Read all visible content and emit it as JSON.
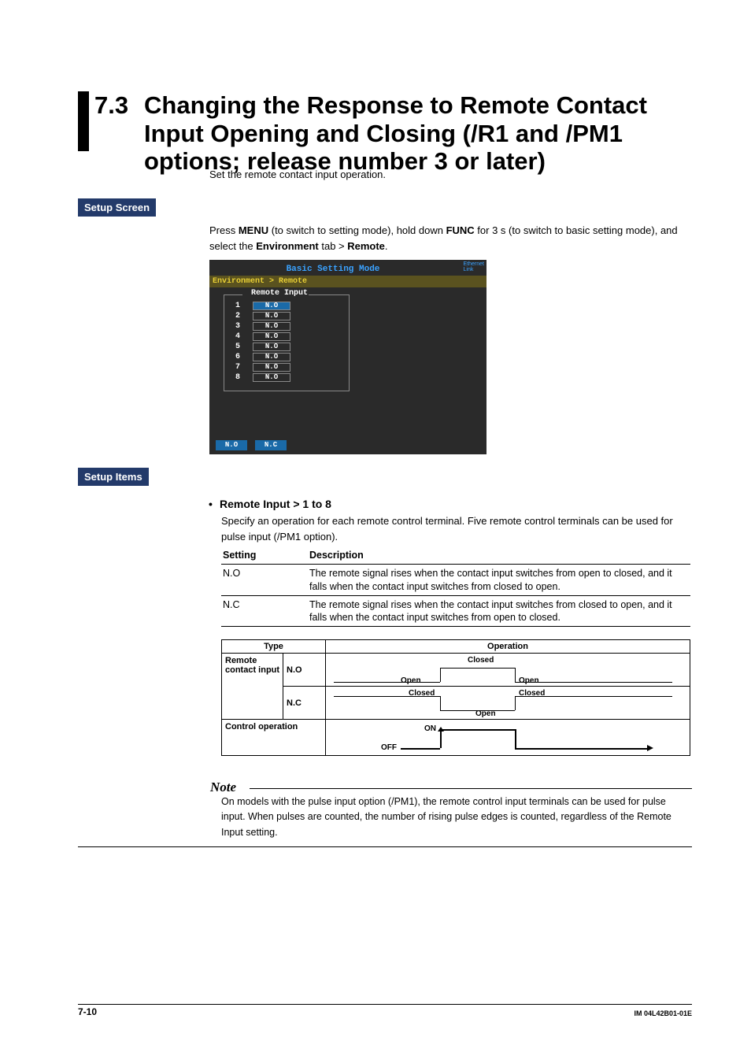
{
  "section_number": "7.3",
  "section_title": "Changing the Response to Remote Contact Input Opening and Closing (/R1 and /PM1 options; release number 3 or later)",
  "intro": "Set the remote contact input operation.",
  "labels": {
    "setup_screen": "Setup Screen",
    "setup_items": "Setup Items"
  },
  "instruction": {
    "prefix": "Press ",
    "menu": "MENU",
    "mid1": " (to switch to setting mode), hold down ",
    "func": "FUNC",
    "mid2": " for 3 s (to switch to basic setting mode), and select the ",
    "env": "Environment",
    "mid3": " tab > ",
    "remote": "Remote",
    "end": "."
  },
  "screenshot": {
    "title": "Basic Setting Mode",
    "eth1": "Ethernet",
    "eth2": "Link",
    "breadcrumb": "Environment > Remote",
    "group_title": "Remote Input",
    "rows": [
      {
        "n": "1",
        "v": "N.O"
      },
      {
        "n": "2",
        "v": "N.O"
      },
      {
        "n": "3",
        "v": "N.O"
      },
      {
        "n": "4",
        "v": "N.O"
      },
      {
        "n": "5",
        "v": "N.O"
      },
      {
        "n": "6",
        "v": "N.O"
      },
      {
        "n": "7",
        "v": "N.O"
      },
      {
        "n": "8",
        "v": "N.O"
      }
    ],
    "fk1": "N.O",
    "fk2": "N.C"
  },
  "bullet_title": "Remote Input > 1 to 8",
  "setup_desc": "Specify an operation for each remote control terminal. Five remote control terminals can be used for pulse input (/PM1 option).",
  "tbl1": {
    "h1": "Setting",
    "h2": "Description",
    "r1c1": "N.O",
    "r1c2": "The remote signal rises when the contact input switches from open to closed, and it falls when the contact input switches from closed to open.",
    "r2c1": "N.C",
    "r2c2": "The remote signal rises when the contact input switches from closed to open, and it falls when the contact input switches from open to closed."
  },
  "tbl2": {
    "h_type": "Type",
    "h_op": "Operation",
    "rci": "Remote contact input",
    "no": "N.O",
    "nc": "N.C",
    "ctrl": "Control operation",
    "closed": "Closed",
    "open": "Open",
    "on": "ON",
    "off": "OFF"
  },
  "note": {
    "head": "Note",
    "body": "On models with the pulse input option (/PM1), the remote control input terminals can be used for pulse input. When pulses are counted, the number of rising pulse edges is counted, regardless of the Remote Input setting."
  },
  "footer": {
    "page": "7-10",
    "doc_id": "IM 04L42B01-01E"
  }
}
